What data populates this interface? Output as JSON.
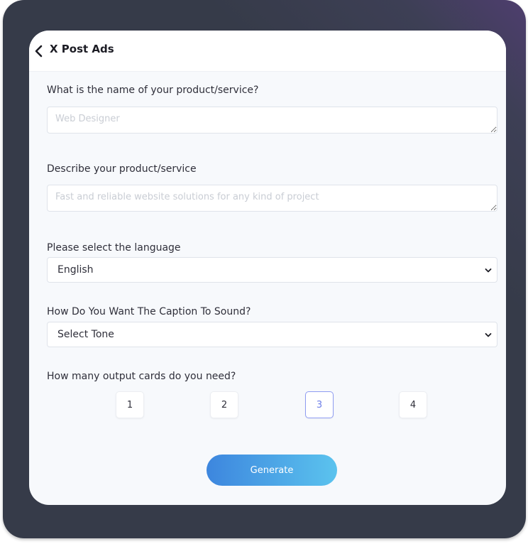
{
  "header": {
    "title": "X Post Ads"
  },
  "form": {
    "product_name": {
      "label": "What is the name of your product/service?",
      "placeholder": "Web Designer",
      "value": ""
    },
    "description": {
      "label": "Describe your product/service",
      "placeholder": "Fast and reliable website solutions for any kind of project",
      "value": ""
    },
    "language": {
      "label": "Please select the language",
      "selected": "English"
    },
    "tone": {
      "label": "How Do You Want The Caption To Sound?",
      "selected": "Select Tone"
    },
    "output_cards": {
      "label": "How many output cards do you need?",
      "options": [
        "1",
        "2",
        "3",
        "4"
      ],
      "selected": "3"
    },
    "generate_label": "Generate"
  },
  "colors": {
    "accent": "#6e7fe8",
    "button_start": "#3d86de",
    "button_end": "#5bc3ee",
    "frame": "#363b49"
  }
}
